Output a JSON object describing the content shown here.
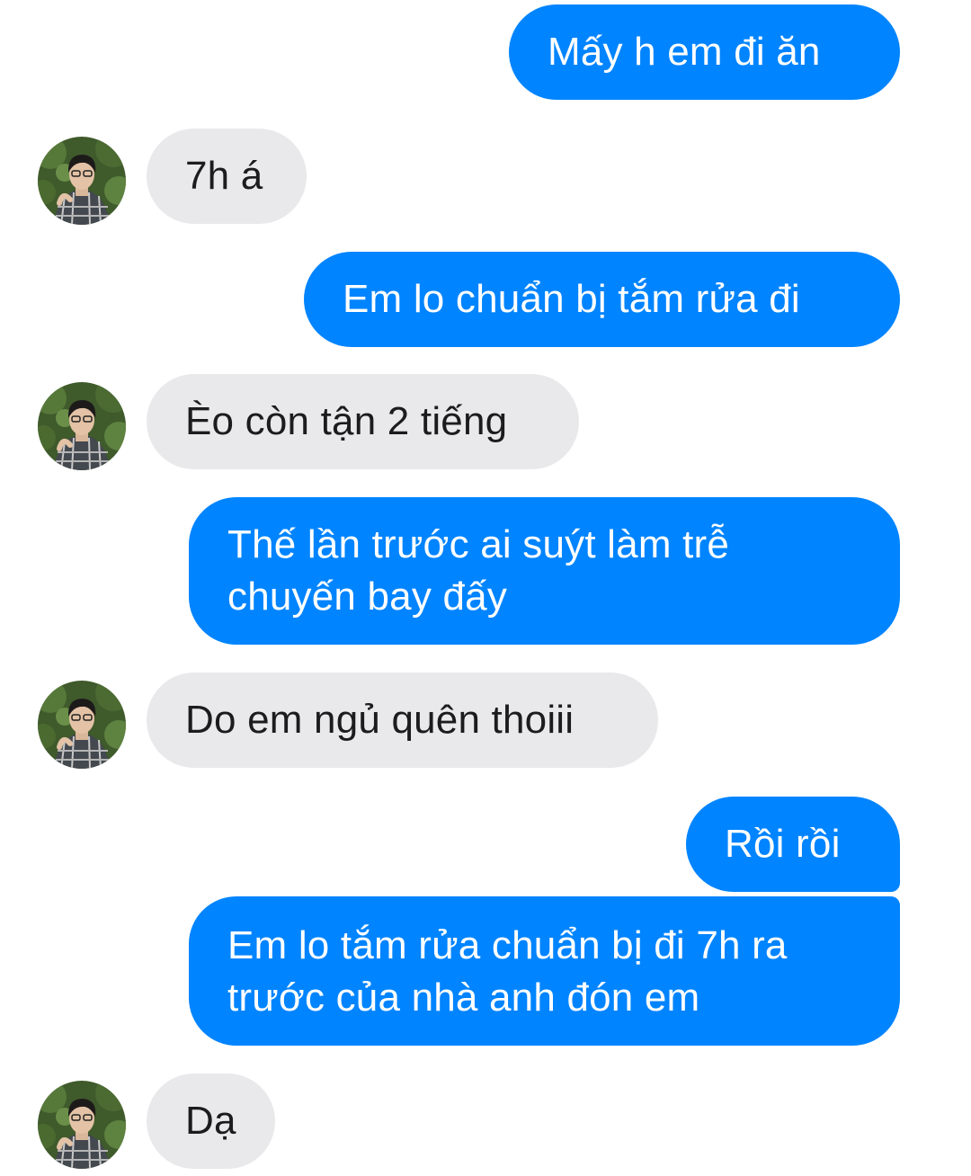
{
  "conversation": {
    "messages": [
      {
        "side": "outgoing",
        "text": "Mấy h em đi ăn"
      },
      {
        "side": "incoming",
        "text": "7h á"
      },
      {
        "side": "outgoing",
        "text": "Em lo chuẩn bị tắm rửa đi"
      },
      {
        "side": "incoming",
        "text": "Èo còn tận 2 tiếng"
      },
      {
        "side": "outgoing",
        "lines": [
          "Thế lần trước ai suýt làm trễ",
          "chuyến bay đấy"
        ]
      },
      {
        "side": "incoming",
        "text": "Do em ngủ quên thoiii"
      },
      {
        "side": "outgoing",
        "text": "Rồi rồi"
      },
      {
        "side": "outgoing",
        "lines": [
          "Em lo tắm rửa chuẩn bị đi 7h ra",
          "trước của nhà anh đón em"
        ]
      },
      {
        "side": "incoming",
        "text": "Dạ"
      }
    ],
    "contact_avatar_icon": "user-photo-avatar"
  },
  "theme": {
    "outgoing_bubble_color": "#0084ff",
    "incoming_bubble_color": "#e9e9eb",
    "outgoing_text_color": "#ffffff",
    "incoming_text_color": "#1c1c1e"
  }
}
